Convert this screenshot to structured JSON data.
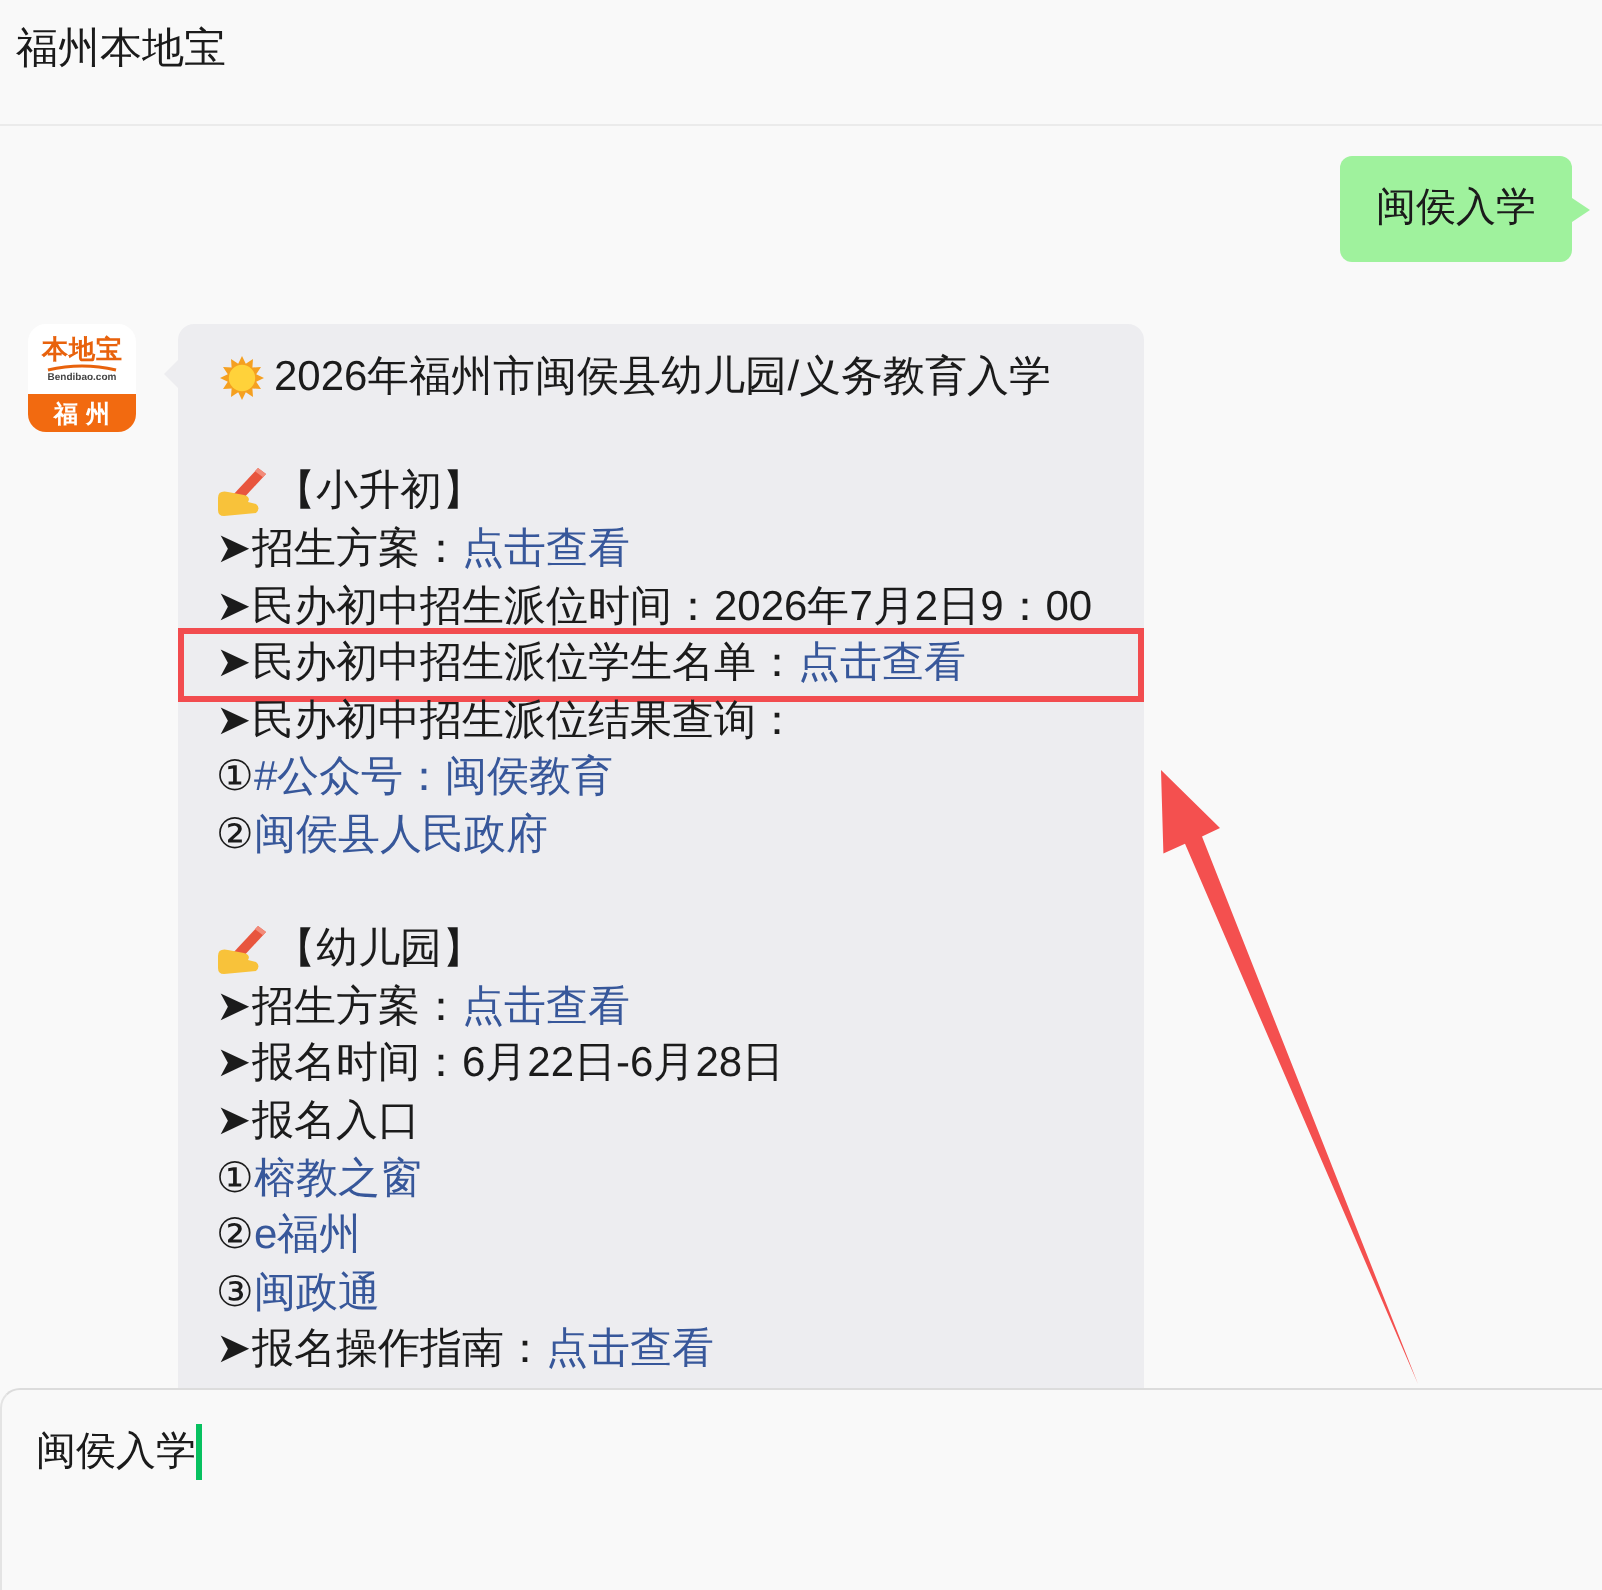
{
  "header": {
    "title": "福州本地宝"
  },
  "messages": [
    {
      "kind": "outgoing",
      "text": "闽侯入学"
    },
    {
      "kind": "incoming",
      "avatar": {
        "brand": "本地宝",
        "site": "Bendibao.com",
        "city": "福州"
      },
      "paragraphs": [
        {
          "lines": [
            {
              "kind": "title",
              "text": "2026年福州市闽侯县幼儿园/义务教育入学",
              "highlighted": false
            }
          ]
        },
        {
          "lines": [
            {
              "kind": "section",
              "text": "【小升初】",
              "highlighted": false
            },
            {
              "kind": "item",
              "text": "➤招生方案：",
              "link": "点击查看",
              "highlighted": false
            },
            {
              "kind": "item",
              "text": "➤民办初中招生派位时间：2026年7月2日9：00",
              "highlighted": false
            },
            {
              "kind": "item",
              "text": "➤民办初中招生派位学生名单：",
              "link": "点击查看",
              "highlighted": true
            },
            {
              "kind": "item",
              "text": "➤民办初中招生派位结果查询：",
              "highlighted": false
            },
            {
              "kind": "option",
              "marker": "①",
              "link": "#公众号：闽侯教育",
              "highlighted": false
            },
            {
              "kind": "option",
              "marker": "②",
              "link": "闽侯县人民政府",
              "highlighted": false
            }
          ]
        },
        {
          "lines": [
            {
              "kind": "section",
              "text": "【幼儿园】",
              "highlighted": false
            },
            {
              "kind": "item",
              "text": "➤招生方案：",
              "link": "点击查看",
              "highlighted": false
            },
            {
              "kind": "item",
              "text": "➤报名时间：6月22日-6月28日",
              "highlighted": false
            },
            {
              "kind": "item",
              "text": "➤报名入口",
              "highlighted": false
            },
            {
              "kind": "option",
              "marker": "①",
              "link": "榕教之窗",
              "highlighted": false
            },
            {
              "kind": "option",
              "marker": "②",
              "link": "e福州",
              "highlighted": false
            },
            {
              "kind": "option",
              "marker": "③",
              "link": "闽政通",
              "highlighted": false
            },
            {
              "kind": "item",
              "text": "➤报名操作指南：",
              "link": "点击查看",
              "highlighted": false
            }
          ]
        }
      ]
    }
  ],
  "composer": {
    "value": "闽侯入学"
  }
}
